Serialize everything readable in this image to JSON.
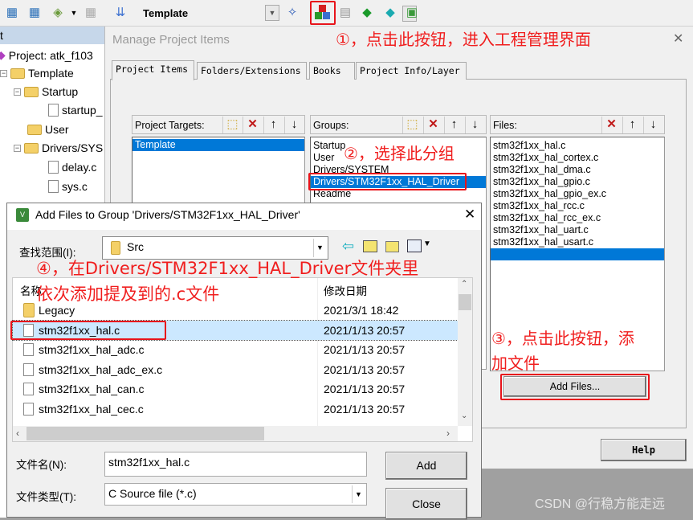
{
  "toolbar": {
    "target_combo": "Template",
    "icons": [
      "translate-icon",
      "batch-build-icon",
      "layers-icon",
      "rebuild-icon",
      "load-icon",
      "dropdown-icon",
      "magic-wand-icon",
      "manage-project-items-icon",
      "window-icon",
      "diamond-green-icon",
      "diamond-cyan-icon",
      "package-icon"
    ]
  },
  "tree": {
    "header": "t",
    "items": [
      "Project: atk_f103",
      "Template",
      "Startup",
      "startup_",
      "User",
      "Drivers/SYS",
      "delay.c",
      "sys.c"
    ]
  },
  "manage": {
    "title": "Manage Project Items",
    "close": "✕",
    "tabs": [
      "Project Items",
      "Folders/Extensions",
      "Books",
      "Project Info/Layer"
    ],
    "targets": {
      "label": "Project Targets:",
      "items": [
        "Template"
      ],
      "selected": 0
    },
    "groups": {
      "label": "Groups:",
      "items": [
        "Startup",
        "User",
        "Drivers/SYSTEM",
        "Drivers/STM32F1xx_HAL_Driver",
        "Readme"
      ],
      "selected": 3
    },
    "files": {
      "label": "Files:",
      "items": [
        "stm32f1xx_hal.c",
        "stm32f1xx_hal_cortex.c",
        "stm32f1xx_hal_dma.c",
        "stm32f1xx_hal_gpio.c",
        "stm32f1xx_hal_gpio_ex.c",
        "stm32f1xx_hal_rcc.c",
        "stm32f1xx_hal_rcc_ex.c",
        "stm32f1xx_hal_uart.c",
        "stm32f1xx_hal_usart.c",
        ""
      ]
    },
    "add_files_button": "Add Files...",
    "help_button": "Help"
  },
  "add_dialog": {
    "title": "Add Files to Group 'Drivers/STM32F1xx_HAL_Driver'",
    "close": "✕",
    "look_in_label": "查找范围(I):",
    "look_in_value": "Src",
    "col_name": "名称",
    "col_date": "修改日期",
    "rows": [
      {
        "name": "Legacy",
        "date": "2021/3/1 18:42",
        "type": "folder"
      },
      {
        "name": "stm32f1xx_hal.c",
        "date": "2021/1/13 20:57",
        "type": "file"
      },
      {
        "name": "stm32f1xx_hal_adc.c",
        "date": "2021/1/13 20:57",
        "type": "file"
      },
      {
        "name": "stm32f1xx_hal_adc_ex.c",
        "date": "2021/1/13 20:57",
        "type": "file"
      },
      {
        "name": "stm32f1xx_hal_can.c",
        "date": "2021/1/13 20:57",
        "type": "file"
      },
      {
        "name": "stm32f1xx_hal_cec.c",
        "date": "2021/1/13 20:57",
        "type": "file"
      }
    ],
    "selected_row": 1,
    "filename_label": "文件名(N):",
    "filename_value": "stm32f1xx_hal.c",
    "filetype_label": "文件类型(T):",
    "filetype_value": "C Source file (*.c)",
    "add_button": "Add",
    "close_button": "Close"
  },
  "annotations": {
    "step1": "①，点击此按钮，进入工程管理界面",
    "step2": "②，选择此分组",
    "step3_line1": "③，点击此按钮，添",
    "step3_line2": "加文件",
    "step4_line1": "④，在Drivers/STM32F1xx_HAL_Driver文件夹里",
    "step4_line2": "依次添加提及到的.c文件"
  },
  "watermark": "CSDN @行稳方能走远",
  "colors": {
    "annotation": "#f01e1e",
    "selection": "#0078d7",
    "row_selection": "#cce8ff"
  }
}
